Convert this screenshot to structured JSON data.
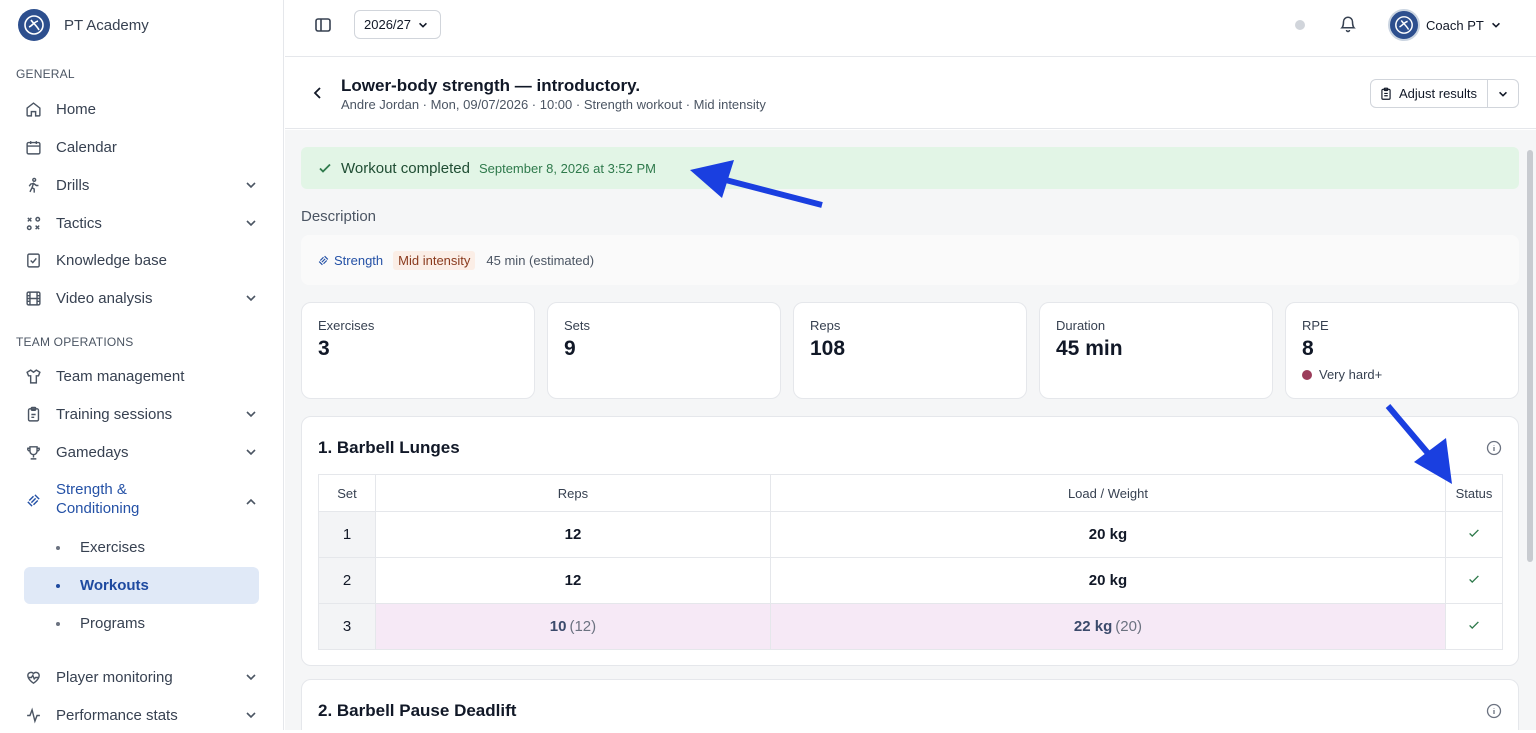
{
  "app": {
    "name": "PT Academy"
  },
  "sidebar": {
    "sections": [
      {
        "label": "GENERAL"
      },
      {
        "label": "TEAM OPERATIONS"
      }
    ],
    "items": [
      {
        "label": "Home"
      },
      {
        "label": "Calendar"
      },
      {
        "label": "Drills"
      },
      {
        "label": "Tactics"
      },
      {
        "label": "Knowledge base"
      },
      {
        "label": "Video analysis"
      },
      {
        "label": "Team management"
      },
      {
        "label": "Training sessions"
      },
      {
        "label": "Gamedays"
      },
      {
        "label": "Strength &\nConditioning",
        "line1": "Strength &",
        "line2": "Conditioning"
      },
      {
        "label": "Player monitoring"
      },
      {
        "label": "Performance stats"
      }
    ],
    "sub_items": [
      {
        "label": "Exercises"
      },
      {
        "label": "Workouts"
      },
      {
        "label": "Programs"
      }
    ]
  },
  "topbar": {
    "season": "2026/27",
    "user_name": "Coach PT"
  },
  "header": {
    "title": "Lower-body strength — introductory.",
    "subtitle": "Andre Jordan · Mon, 09/07/2026 · 10:00 · Strength workout · Mid intensity",
    "adjust_label": "Adjust results"
  },
  "banner": {
    "title": "Workout completed",
    "time": "September 8, 2026 at 3:52 PM"
  },
  "description": {
    "label": "Description",
    "category": "Strength",
    "intensity": "Mid intensity",
    "duration": "45 min (estimated)"
  },
  "stats": [
    {
      "label": "Exercises",
      "value": "3"
    },
    {
      "label": "Sets",
      "value": "9"
    },
    {
      "label": "Reps",
      "value": "108"
    },
    {
      "label": "Duration",
      "value": "45 min"
    },
    {
      "label": "RPE",
      "value": "8",
      "note": "Very hard+",
      "note_color": "#9b3c5a"
    }
  ],
  "exercises": [
    {
      "title": "1. Barbell Lunges",
      "columns": [
        "Set",
        "Reps",
        "Load / Weight",
        "Status"
      ],
      "rows": [
        {
          "set": "1",
          "reps": "12",
          "load": "20 kg",
          "reps_planned": "",
          "load_planned": ""
        },
        {
          "set": "2",
          "reps": "12",
          "load": "20 kg",
          "reps_planned": "",
          "load_planned": ""
        },
        {
          "set": "3",
          "reps": "10",
          "load": "22 kg",
          "reps_planned": "(12)",
          "load_planned": "(20)"
        }
      ]
    },
    {
      "title": "2. Barbell Pause Deadlift"
    }
  ],
  "colors": {
    "accent": "#2451a6",
    "success_bg": "#e2f5e6",
    "adjusted_bg": "#f6e9f6",
    "annotation_arrow": "#1a3fe0"
  }
}
